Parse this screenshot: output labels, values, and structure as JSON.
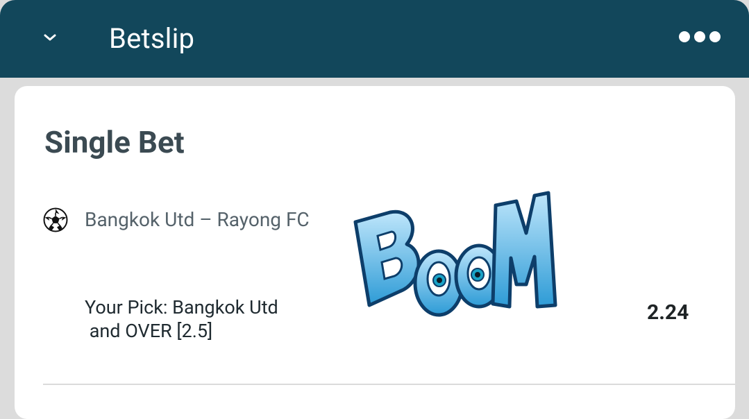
{
  "header": {
    "title": "Betslip",
    "collapse_icon": "chevron-down-icon",
    "menu_icon": "more-horizontal-icon",
    "background_color": "#12475b"
  },
  "bet": {
    "section_title": "Single Bet",
    "sport_icon": "soccer-ball-icon",
    "event": "Bangkok Utd – Rayong FC",
    "pick_line1": "Your Pick: Bangkok Utd",
    "pick_line2": "and OVER [2.5]",
    "odds": "2.24"
  },
  "sticker": {
    "text": "BOOM",
    "color": "#3aa9e0"
  }
}
